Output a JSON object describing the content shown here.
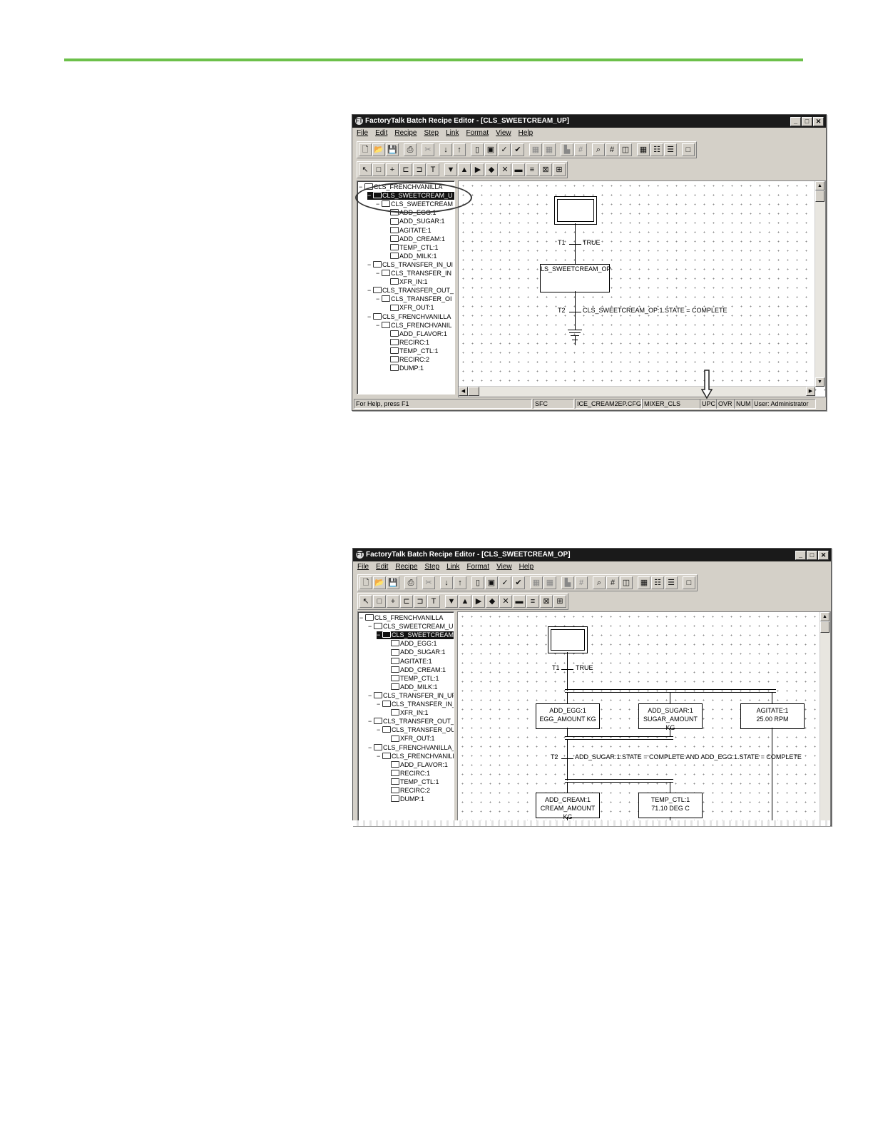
{
  "window1": {
    "title": "FactoryTalk Batch Recipe Editor - [CLS_SWEETCREAM_UP]",
    "app_icon": "FT",
    "menu": [
      "File",
      "Edit",
      "Recipe",
      "Step",
      "Link",
      "Format",
      "View",
      "Help"
    ],
    "tree": [
      {
        "exp": "−",
        "label": "CLS_FRENCHVANILLA",
        "indent": 0,
        "selected": false
      },
      {
        "exp": "−",
        "label": "CLS_SWEETCREAM_U",
        "indent": 1,
        "selected": true
      },
      {
        "exp": "−",
        "label": "CLS_SWEETCREAM",
        "indent": 2,
        "selected": false
      },
      {
        "exp": "",
        "label": "ADD_EGG:1",
        "indent": 3,
        "selected": false
      },
      {
        "exp": "",
        "label": "ADD_SUGAR:1",
        "indent": 3,
        "selected": false
      },
      {
        "exp": "",
        "label": "AGITATE:1",
        "indent": 3,
        "selected": false
      },
      {
        "exp": "",
        "label": "ADD_CREAM:1",
        "indent": 3,
        "selected": false
      },
      {
        "exp": "",
        "label": "TEMP_CTL:1",
        "indent": 3,
        "selected": false
      },
      {
        "exp": "",
        "label": "ADD_MILK:1",
        "indent": 3,
        "selected": false
      },
      {
        "exp": "−",
        "label": "CLS_TRANSFER_IN_UI",
        "indent": 1,
        "selected": false
      },
      {
        "exp": "−",
        "label": "CLS_TRANSFER_IN",
        "indent": 2,
        "selected": false
      },
      {
        "exp": "",
        "label": "XFR_IN:1",
        "indent": 3,
        "selected": false
      },
      {
        "exp": "−",
        "label": "CLS_TRANSFER_OUT_",
        "indent": 1,
        "selected": false
      },
      {
        "exp": "−",
        "label": "CLS_TRANSFER_OI",
        "indent": 2,
        "selected": false
      },
      {
        "exp": "",
        "label": "XFR_OUT:1",
        "indent": 3,
        "selected": false
      },
      {
        "exp": "−",
        "label": "CLS_FRENCHVANILLA",
        "indent": 1,
        "selected": false
      },
      {
        "exp": "−",
        "label": "CLS_FRENCHVANIL",
        "indent": 2,
        "selected": false
      },
      {
        "exp": "",
        "label": "ADD_FLAVOR:1",
        "indent": 3,
        "selected": false
      },
      {
        "exp": "",
        "label": "RECIRC:1",
        "indent": 3,
        "selected": false
      },
      {
        "exp": "",
        "label": "TEMP_CTL:1",
        "indent": 3,
        "selected": false
      },
      {
        "exp": "",
        "label": "RECIRC:2",
        "indent": 3,
        "selected": false
      },
      {
        "exp": "",
        "label": "DUMP:1",
        "indent": 3,
        "selected": false
      }
    ],
    "sfc": {
      "t1_name": "T1",
      "t1_cond": "TRUE",
      "step_label": "LS_SWEETCREAM_OP",
      "t2_name": "T2",
      "t2_cond": "CLS_SWEETCREAM_OP:1.STATE = COMPLETE"
    },
    "status": {
      "help": "For Help, press F1",
      "mode": "SFC",
      "config": "ICE_CREAM2EP.CFG",
      "unit": "MIXER_CLS",
      "upc": "UPC",
      "ovr": "OVR",
      "num": "NUM",
      "user": "User: Administrator"
    }
  },
  "window2": {
    "title": "FactoryTalk Batch Recipe Editor - [CLS_SWEETCREAM_OP]",
    "app_icon": "FT",
    "menu": [
      "File",
      "Edit",
      "Recipe",
      "Step",
      "Link",
      "Format",
      "View",
      "Help"
    ],
    "tree": [
      {
        "exp": "−",
        "label": "CLS_FRENCHVANILLA",
        "indent": 0,
        "selected": false
      },
      {
        "exp": "−",
        "label": "CLS_SWEETCREAM_UP:",
        "indent": 1,
        "selected": false
      },
      {
        "exp": "−",
        "label": "CLS_SWEETCREAM_C",
        "indent": 2,
        "selected": true
      },
      {
        "exp": "",
        "label": "ADD_EGG:1",
        "indent": 3,
        "selected": false
      },
      {
        "exp": "",
        "label": "ADD_SUGAR:1",
        "indent": 3,
        "selected": false
      },
      {
        "exp": "",
        "label": "AGITATE:1",
        "indent": 3,
        "selected": false
      },
      {
        "exp": "",
        "label": "ADD_CREAM:1",
        "indent": 3,
        "selected": false
      },
      {
        "exp": "",
        "label": "TEMP_CTL:1",
        "indent": 3,
        "selected": false
      },
      {
        "exp": "",
        "label": "ADD_MILK:1",
        "indent": 3,
        "selected": false
      },
      {
        "exp": "−",
        "label": "CLS_TRANSFER_IN_UP:1",
        "indent": 1,
        "selected": false
      },
      {
        "exp": "−",
        "label": "CLS_TRANSFER_IN_C",
        "indent": 2,
        "selected": false
      },
      {
        "exp": "",
        "label": "XFR_IN:1",
        "indent": 3,
        "selected": false
      },
      {
        "exp": "−",
        "label": "CLS_TRANSFER_OUT_UI",
        "indent": 1,
        "selected": false
      },
      {
        "exp": "−",
        "label": "CLS_TRANSFER_OUT",
        "indent": 2,
        "selected": false
      },
      {
        "exp": "",
        "label": "XFR_OUT:1",
        "indent": 3,
        "selected": false
      },
      {
        "exp": "−",
        "label": "CLS_FRENCHVANILLA_U",
        "indent": 1,
        "selected": false
      },
      {
        "exp": "−",
        "label": "CLS_FRENCHVANILLA",
        "indent": 2,
        "selected": false
      },
      {
        "exp": "",
        "label": "ADD_FLAVOR:1",
        "indent": 3,
        "selected": false
      },
      {
        "exp": "",
        "label": "RECIRC:1",
        "indent": 3,
        "selected": false
      },
      {
        "exp": "",
        "label": "TEMP_CTL:1",
        "indent": 3,
        "selected": false
      },
      {
        "exp": "",
        "label": "RECIRC:2",
        "indent": 3,
        "selected": false
      },
      {
        "exp": "",
        "label": "DUMP:1",
        "indent": 3,
        "selected": false
      }
    ],
    "sfc": {
      "t1_name": "T1",
      "t1_cond": "TRUE",
      "steps": [
        {
          "name": "ADD_EGG:1",
          "param": "EGG_AMOUNT KG"
        },
        {
          "name": "ADD_SUGAR:1",
          "param": "SUGAR_AMOUNT KG"
        },
        {
          "name": "AGITATE:1",
          "param": "25.00 RPM"
        },
        {
          "name": "ADD_CREAM:1",
          "param": "CREAM_AMOUNT KG"
        },
        {
          "name": "TEMP_CTL:1",
          "param": "71.10 DEG C"
        }
      ],
      "t2_name": "T2",
      "t2_cond": "ADD_SUGAR:1.STATE = COMPLETE AND ADD_EGG:1.STATE = COMPLETE"
    }
  }
}
